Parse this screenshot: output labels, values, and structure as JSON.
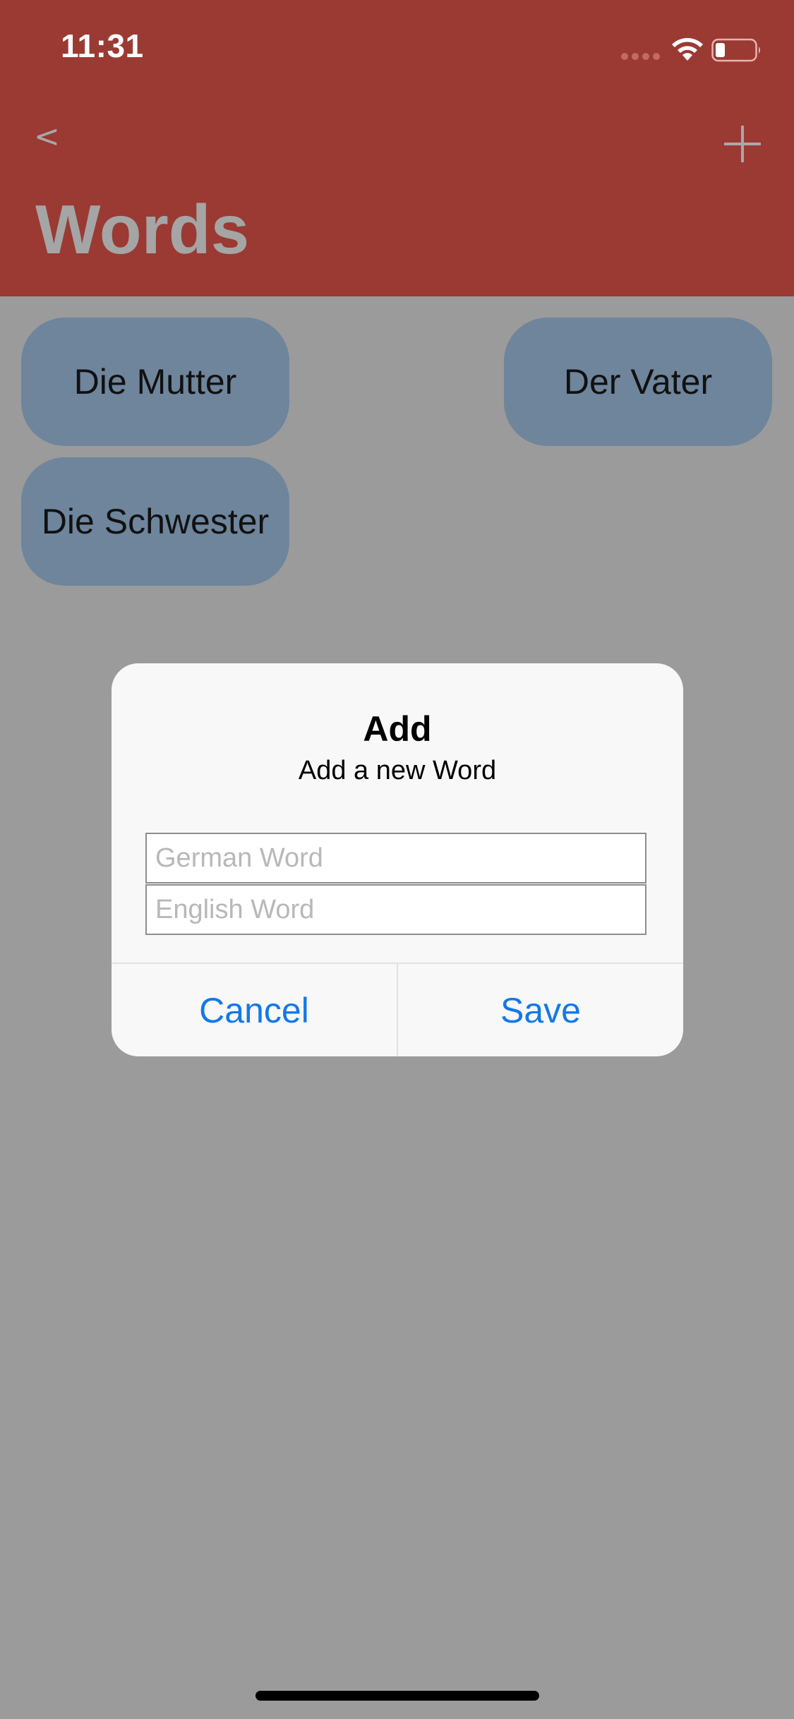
{
  "status_bar": {
    "time": "11:31"
  },
  "nav": {
    "back_label": "<",
    "title": "Words",
    "add_icon": "plus-icon"
  },
  "words": [
    {
      "label": "Die Mutter"
    },
    {
      "label": "Der Vater"
    },
    {
      "label": "Die Schwester"
    }
  ],
  "dialog": {
    "title": "Add",
    "message": "Add a new Word",
    "german_placeholder": "German Word",
    "english_placeholder": "English Word",
    "cancel_label": "Cancel",
    "save_label": "Save"
  },
  "colors": {
    "header": "#9a3a33",
    "background_dimmed": "#9b9b9b",
    "word_bubble": "#6e859c",
    "accent": "#1478e6"
  }
}
